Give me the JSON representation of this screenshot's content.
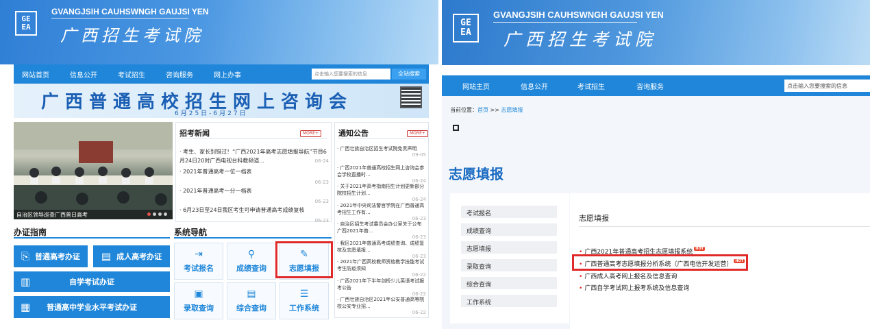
{
  "left": {
    "logo_text": [
      "GE",
      "EA"
    ],
    "banner_en": "GVANGJSIH CAUHSWNGH GAUJSI YEN",
    "banner_cn": "广西招生考试院",
    "nav": [
      "网站首页",
      "信息公开",
      "考试招生",
      "咨询服务",
      "网上办事"
    ],
    "search_placeholder": "点击输入您要搜索的信息",
    "search_button": "全站搜索",
    "consult_title": "广西普通高校招生网上咨询会",
    "consult_date": "6月25日-6月27日",
    "photo_caption": "自治区领导巡查广西普日高考",
    "news": {
      "title": "招考新闻",
      "more": "MORE+",
      "items": [
        {
          "text": "考生、家长别错过！“广西2021年高考志愿填报导航”节目6月24日20时广西电视台科教频道...",
          "date": "06-24"
        },
        {
          "text": "2021年普通高考一位一档表",
          "date": "06-23"
        },
        {
          "text": "2021年普通高考一分一档表",
          "date": "06-23"
        },
        {
          "text": "6月23日至24日我区考生可申请普通高考成绩复核",
          "date": "06-23"
        }
      ]
    },
    "notice": {
      "title": "通知公告",
      "more": "MORE+",
      "items": [
        {
          "text": "广西壮族自治区招生考试院免责声明",
          "date": "09-05"
        },
        {
          "text": "广西2021年普通高校招生网上咨询会参会学校直播时...",
          "date": "06-24"
        },
        {
          "text": "关于2021年高考指南招生计划更新部分院校招生计划...",
          "date": "06-24"
        },
        {
          "text": "2021年中央司法警官学院在广西普通高考招生工作有...",
          "date": "06-23"
        },
        {
          "text": "自治区招生考试委员会办公室关于公布广西2021年普...",
          "date": "06-23"
        },
        {
          "text": "我区2021年普通高考成绩查询、成绩复核及志愿填报...",
          "date": "06-23"
        },
        {
          "text": "2021年广西高校教师资格教学技能考试考生防疫须知",
          "date": "06-22"
        },
        {
          "text": "广西2021年下半年剑桥少儿英语考试报考公告",
          "date": "06-22"
        },
        {
          "text": "广西壮族自治区2021年公安普通高等院校公安专业招...",
          "date": "06-22"
        }
      ]
    },
    "guide": {
      "title": "办证指南",
      "buttons": [
        "普通高考办证",
        "成人高考办证",
        "自学考试办证",
        "普通高中学业水平考试办证"
      ]
    },
    "sysnav": {
      "title": "系统导航",
      "tiles": [
        "考试报名",
        "成绩查询",
        "志愿填报",
        "录取查询",
        "综合查询",
        "工作系统"
      ]
    }
  },
  "right": {
    "logo_text": [
      "GE",
      "EA"
    ],
    "banner_en": "GVANGJSIH CAUHSWNGH GAUJSI YEN",
    "banner_cn": "广西招生考试院",
    "nav": [
      "网站主页",
      "信息公开",
      "考试招生",
      "咨询服务"
    ],
    "search_placeholder": "点击输入您要搜索的信息",
    "breadcrumb": {
      "prefix": "当前位置：",
      "home": "首页",
      "sep": " >> ",
      "current": "志愿填报"
    },
    "page_heading": "志愿填报",
    "menu": [
      "考试报名",
      "成绩查询",
      "志愿填报",
      "录取查询",
      "综合查询",
      "工作系统"
    ],
    "content_title": "志愿填报",
    "hot_label": "HOT",
    "links": [
      {
        "text": "广西2021年普通高考招生志愿填报系统",
        "hot": true
      },
      {
        "text": "广西普通高考志愿填报分析系统（广西电信开发运营）",
        "hot": true
      },
      {
        "text": "广西成人高考网上报名及信息查询",
        "hot": false
      },
      {
        "text": "广西自学考试网上报考系统及信息查询",
        "hot": false
      }
    ]
  },
  "colors": {
    "primary_blue": "#1f86d9",
    "highlight_red": "#e02a2a"
  }
}
